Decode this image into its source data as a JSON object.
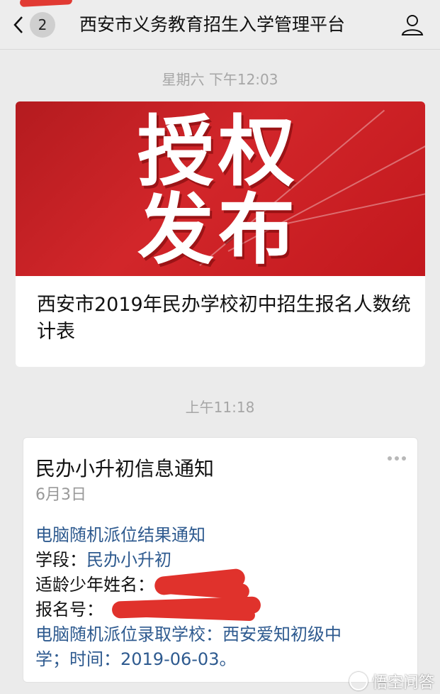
{
  "header": {
    "back_count": "2",
    "title": "西安市义务教育招生入学管理平台"
  },
  "messages": [
    {
      "time": "星期六 下午12:03",
      "banner_line1": "授权",
      "banner_line2": "发布",
      "article_title": "西安市2019年民办学校初中招生报名人数统计表"
    },
    {
      "time": "上午11:18",
      "title": "民办小升初信息通知",
      "date": "6月3日",
      "body": {
        "heading": "电脑随机派位结果通知",
        "stage_label": "学段：",
        "stage_value": "民办小升初",
        "name_label": "适龄少年姓名：",
        "reg_label": "报名号：",
        "school_label": "电脑随机派位录取学校：",
        "school_value": "西安爱知初级中学；时间：2019-06-03。"
      }
    }
  ],
  "watermark": "悟空问答"
}
